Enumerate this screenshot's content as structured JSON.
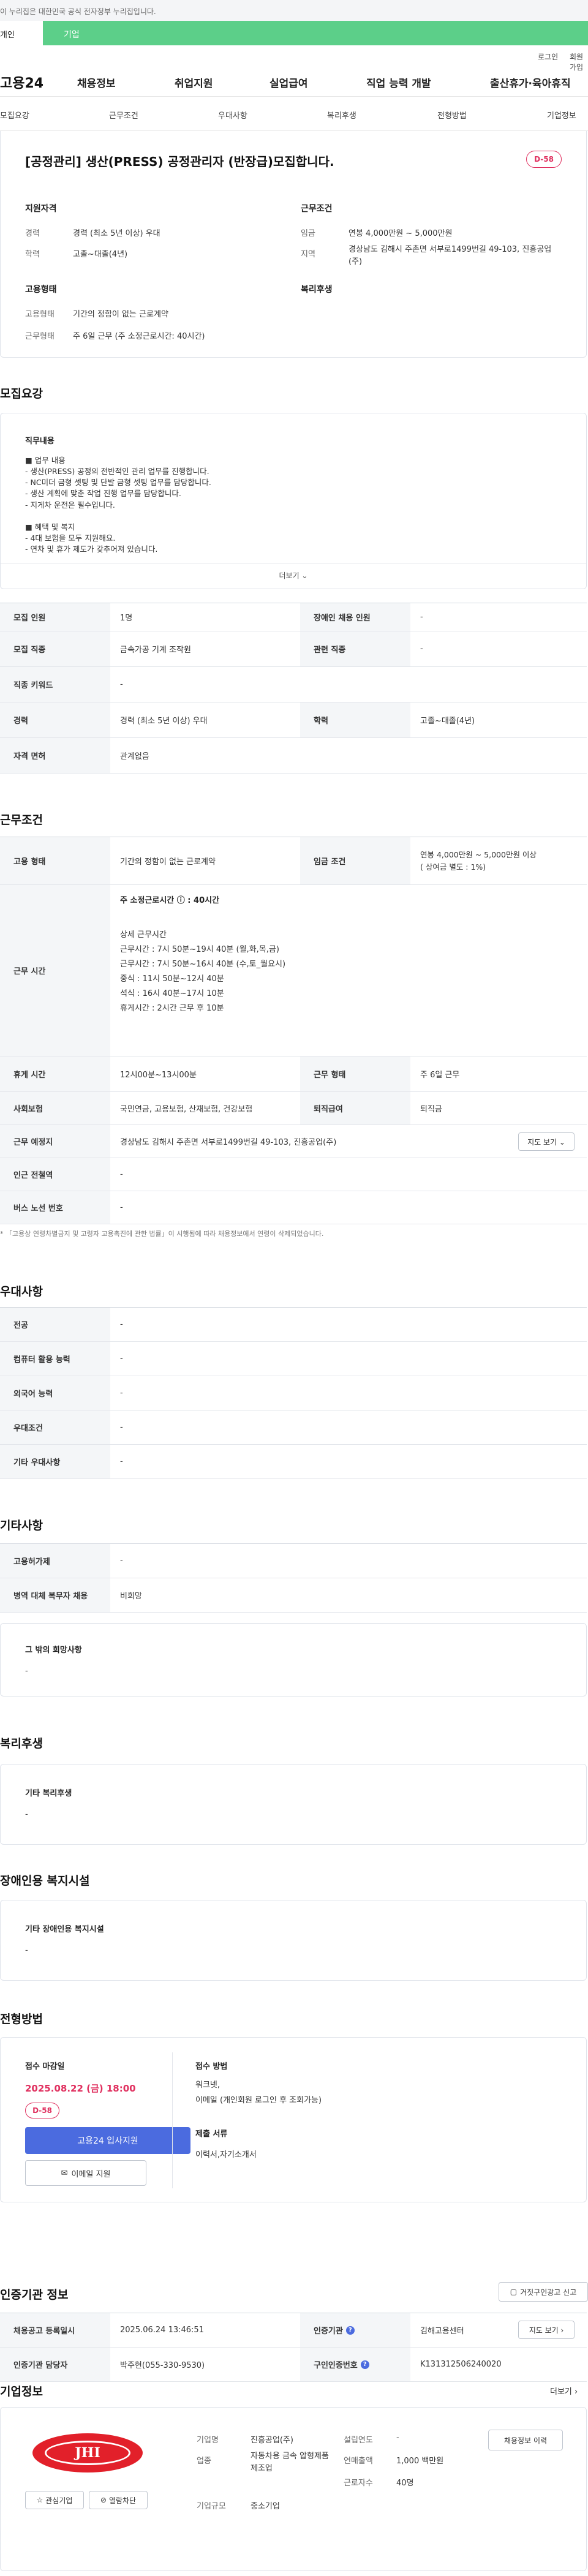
{
  "banner": {
    "text": "이 누리집은 대한민국 공식 전자정부 누리집입니다.",
    "tab_a": "개인",
    "tab_b": "기업"
  },
  "util": {
    "login": "로그인",
    "join": "회원가입"
  },
  "gnb": {
    "logo": "고용24",
    "menu": [
      "채용정보",
      "취업지원",
      "실업급여",
      "직업 능력 개발",
      "출산휴가·육아휴직"
    ]
  },
  "snb": [
    "모집요강",
    "근무조건",
    "우대사항",
    "복리후생",
    "전형방법",
    "기업정보"
  ],
  "title": {
    "text": "[공정관리] 생산(PRESS) 공정관리자 (반장급)모집합니다.",
    "dday": "D-58"
  },
  "summary": {
    "qual_title": "지원자격",
    "career_lbl": "경력",
    "career_val": "경력 (최소 5년 이상) 우대",
    "edu_lbl": "학력",
    "edu_val": "고졸~대졸(4년)",
    "cond_title": "근무조건",
    "wage_lbl": "임금",
    "wage_val": "연봉 4,000만원 ~ 5,000만원",
    "area_lbl": "지역",
    "area_val": "경상남도 김해시 주촌면 서부로1499번길 49-103, 진흥공업(주)",
    "emp_title": "고용형태",
    "emptype_lbl": "고용형태",
    "emptype_val": "기간의 정함이 없는 근로계약",
    "hours_lbl": "근무형태",
    "hours_val": "주 6일 근무 (주 소정근로시간: 40시간)",
    "welfare_title": "복리후생"
  },
  "recruit": {
    "heading": "모집요강",
    "duty_title": "직무내용",
    "duty_text": "■ 업무 내용\n- 생산(PRESS) 공정의 전반적인 관리 업무를 진행합니다.\n- NC미더 금형 셋팅 및 단발 금형 셋팅 업무를 담당합니다.\n- 생산 계획에 맞춘 작업 진행 업무를 담당합니다.\n- 지게차 운전은 필수입니다.\n\n■ 혜택 및 복지\n- 4대 보험을 모두 지원해요.\n- 연차 및 휴가 제도가 갖추어져 있습니다.",
    "more": "더보기 ⌄",
    "rows": [
      {
        "k1": "모집 인원",
        "v1": "1명",
        "k2": "장애인 채용 인원",
        "v2": "-"
      },
      {
        "k1": "모집 직종",
        "v1": "금속가공 기계 조작원",
        "k2": "관련 직종",
        "v2": "-"
      },
      {
        "k1": "직종 키워드",
        "v1": "-"
      },
      {
        "k1": "경력",
        "v1": "경력 (최소 5년 이상) 우대",
        "k2": "학력",
        "v2": "고졸~대졸(4년)"
      },
      {
        "k1": "자격 면허",
        "v1": "관계없음"
      }
    ]
  },
  "work": {
    "heading": "근무조건",
    "emp_k": "고용 형태",
    "emp_v": "기간의 정함이 없는 근로계약",
    "wage_k": "임금 조건",
    "wage_v": "연봉 4,000만원 ~ 5,000만원 이상\n( 상여금 별도 : 1%)",
    "time_k": "근무 시간",
    "time_head": "주 소정근로시간 ⓘ : 40시간",
    "time_detail": "상세 근무시간\n근무시간 : 7시 50분~19시 40분 (월,화,목,금)\n근무시간 : 7시 50분~16시 40분 (수,토_월요시)\n중식 : 11시 50분~12시 40분\n석식 : 16시 40분~17시 10분\n휴게시간 : 2시간 근무 후 10분",
    "rest_k": "휴게 시간",
    "rest_v": "12시00분~13시00분",
    "shift_k": "근무 형태",
    "shift_v": "주 6일 근무",
    "ins_k": "사회보험",
    "ins_v": "국민연금, 고용보험, 산재보험, 건강보험",
    "ret_k": "퇴직급여",
    "ret_v": "퇴직금",
    "place_k": "근무 예정지",
    "place_v": "경상남도 김해시 주촌면 서부로1499번길 49-103, 진흥공업(주)",
    "map_btn": "지도 보기 ⌄",
    "sub_k": "인근 전철역",
    "sub_v": "-",
    "bus_k": "버스 노선 번호",
    "bus_v": "-",
    "note": "* 「고용상 연령차별금지 및 고령자 고용촉진에 관한 법률」이 시행됨에 따라 채용정보에서 연령이 삭제되었습니다."
  },
  "pref": {
    "heading": "우대사항",
    "rows": [
      {
        "k": "전공",
        "v": "-"
      },
      {
        "k": "컴퓨터 활용 능력",
        "v": "-"
      },
      {
        "k": "외국어 능력",
        "v": "-"
      },
      {
        "k": "우대조건",
        "v": "-"
      },
      {
        "k": "기타 우대사항",
        "v": "-"
      }
    ]
  },
  "etc": {
    "heading": "기타사항",
    "rows": [
      {
        "k": "고용허가제",
        "v": "-"
      },
      {
        "k": "병역 대체 복무자 채용",
        "v": "비희망"
      }
    ],
    "wish_title": "그 밖의 희망사항",
    "wish_val": "-"
  },
  "welfare": {
    "heading": "복리후생",
    "title": "기타 복리후생",
    "val": "-"
  },
  "disabled": {
    "heading": "장애인용 복지시설",
    "title": "기타 장애인용 복지시설",
    "val": "-"
  },
  "process": {
    "heading": "전형방법",
    "deadline_lbl": "접수 마감일",
    "deadline_val": "2025.08.22 (금) 18:00",
    "dday": "D-58",
    "apply_btn": "고용24 입사지원",
    "email_btn": "이메일 지원",
    "method_lbl": "접수 방법",
    "method_val": "워크넷,\n이메일 (개인회원 로그인 후 조회가능)",
    "docs_lbl": "제출 서류",
    "docs_val": "이력서,자기소개서"
  },
  "cert": {
    "heading": "인증기관 정보",
    "report_btn": "거짓구인광고 신고",
    "date_k": "채용공고 등록일시",
    "date_v": "2025.06.24 13:46:51",
    "org_k": "인증기관",
    "org_v": "김해고용센터",
    "map_btn": "지도 보기 ›",
    "mgr_k": "인증기관 담당자",
    "mgr_v": "박주현(055-330-9530)",
    "no_k": "구인인증번호",
    "no_v": "K131312506240020"
  },
  "company": {
    "heading": "기업정보",
    "more": "더보기 ›",
    "logo_text": "JHI",
    "fav_btn": "관심기업",
    "block_btn": "열람차단",
    "name_k": "기업명",
    "name_v": "진흥공업(주)",
    "ind_k": "업종",
    "ind_v": "자동차용 금속 압형제품 제조업",
    "size_k": "기업규모",
    "size_v": "중소기업",
    "year_k": "설립연도",
    "year_v": "-",
    "sales_k": "연매출액",
    "sales_v": "1,000 백만원",
    "staff_k": "근로자수",
    "staff_v": "40명",
    "hist_btn": "채용정보 이력"
  },
  "colors": {
    "accent": "#4b6bdf",
    "dday": "#e0305f",
    "brand": "#5ccf89",
    "deadline": "#e0305f"
  }
}
